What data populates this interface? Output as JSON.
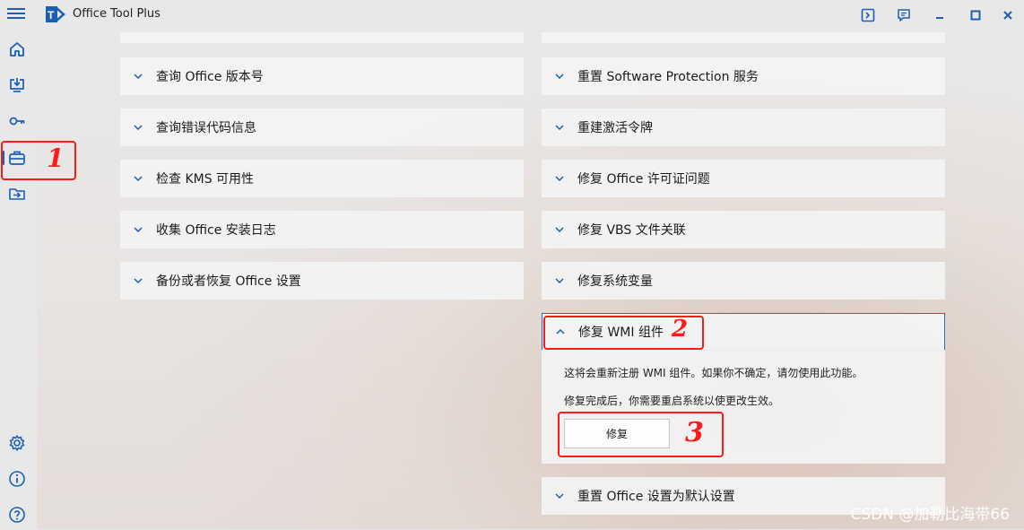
{
  "window": {
    "title": "Office Tool Plus",
    "accent": "#1a5fb4",
    "controls": [
      {
        "name": "terminal-icon"
      },
      {
        "name": "feedback-icon"
      },
      {
        "name": "minimize-icon"
      },
      {
        "name": "maximize-icon"
      },
      {
        "name": "close-icon"
      }
    ]
  },
  "sidebar": {
    "items": [
      {
        "name": "home-icon"
      },
      {
        "name": "deploy-icon"
      },
      {
        "name": "activation-key-icon"
      },
      {
        "name": "toolbox-icon",
        "active": true
      },
      {
        "name": "convert-icon"
      },
      {
        "name": "settings-icon"
      },
      {
        "name": "info-icon"
      },
      {
        "name": "help-icon"
      }
    ]
  },
  "annotations": {
    "one": "1",
    "two": "2",
    "three": "3",
    "color": "#ff1a1a"
  },
  "left_panels": [
    "查询 Office 版本号",
    "查询错误代码信息",
    "检查 KMS 可用性",
    "收集 Office 安装日志",
    "备份或者恢复 Office 设置"
  ],
  "right_panels": [
    "重置 Software Protection 服务",
    "重建激活令牌",
    "修复 Office 许可证问题",
    "修复 VBS 文件关联",
    "修复系统变量"
  ],
  "expanded": {
    "title": "修复 WMI 组件",
    "description": "这将会重新注册 WMI 组件。如果你不确定，请勿使用此功能。",
    "note": "修复完成后，你需要重启系统以使更改生效。",
    "button": "修复"
  },
  "last_panel": "重置 Office 设置为默认设置",
  "watermark": "CSDN @加勒比海带66"
}
